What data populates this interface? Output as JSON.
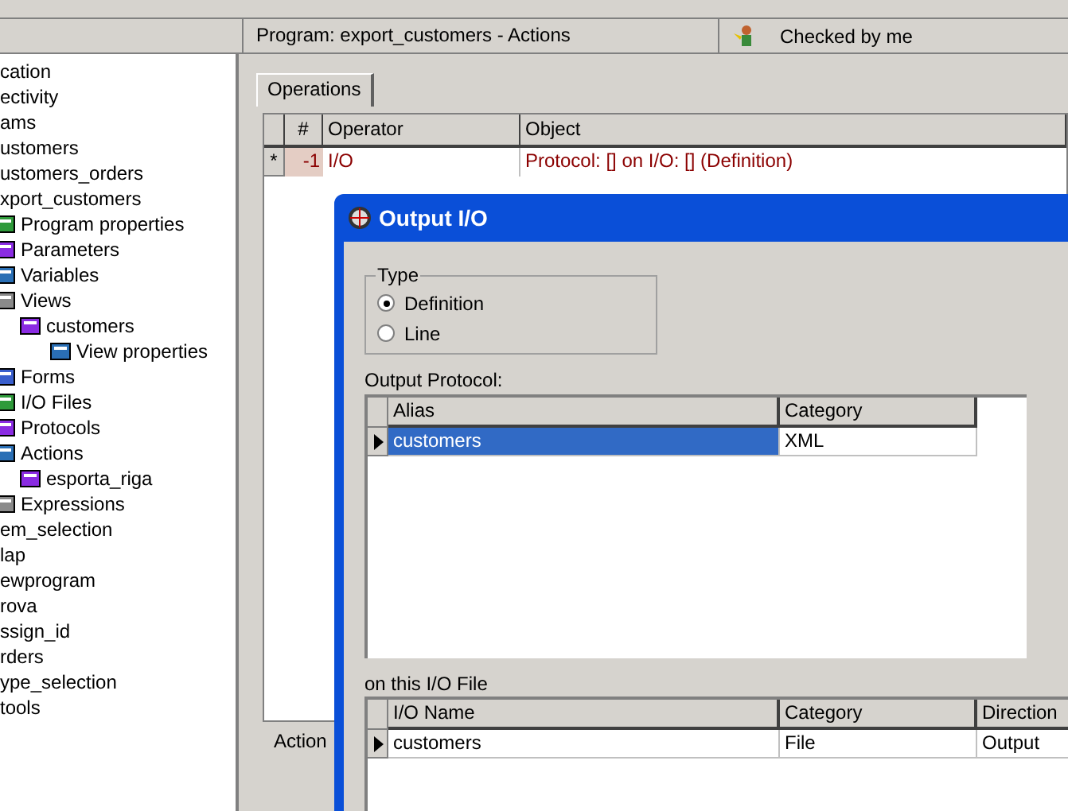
{
  "tree": [
    {
      "label": "cation"
    },
    {
      "label": "ectivity"
    },
    {
      "label": "ams"
    },
    {
      "label": "ustomers"
    },
    {
      "label": "ustomers_orders"
    },
    {
      "label": "xport_customers",
      "children": [
        {
          "label": "Program properties"
        },
        {
          "label": "Parameters"
        },
        {
          "label": "Variables"
        },
        {
          "label": "Views",
          "children": [
            {
              "label": "customers",
              "children": [
                {
                  "label": "View properties"
                }
              ]
            }
          ]
        },
        {
          "label": "Forms"
        },
        {
          "label": "I/O Files"
        },
        {
          "label": "Protocols"
        },
        {
          "label": "Actions",
          "children": [
            {
              "label": "esporta_riga"
            }
          ]
        },
        {
          "label": "Expressions"
        }
      ]
    },
    {
      "label": "em_selection"
    },
    {
      "label": "lap"
    },
    {
      "label": "ewprogram"
    },
    {
      "label": "rova"
    },
    {
      "label": "ssign_id"
    },
    {
      "label": "rders"
    },
    {
      "label": "ype_selection"
    },
    {
      "label": "tools"
    }
  ],
  "header": {
    "title": "Program: export_customers - Actions",
    "status": "Checked by me"
  },
  "tabs": [
    {
      "label": "Operations",
      "selected": true
    }
  ],
  "operations_grid": {
    "columns": [
      "#",
      "Operator",
      "Object"
    ],
    "rows": [
      {
        "marker": "*",
        "number": "-1",
        "operator": "I/O",
        "object": "Protocol: [] on I/O: [] (Definition)"
      }
    ]
  },
  "bottom_tabs": [
    {
      "label": "Action",
      "selected": false
    }
  ],
  "dialog": {
    "title": "Output I/O",
    "type_group": {
      "label": "Type",
      "options": [
        {
          "label": "Definition",
          "selected": true
        },
        {
          "label": "Line",
          "selected": false
        }
      ]
    },
    "protocol_label": "Output Protocol:",
    "protocol_grid": {
      "columns": [
        "Alias",
        "Category"
      ],
      "rows": [
        {
          "cells": [
            "customers",
            "XML"
          ],
          "current": true,
          "selected": true
        }
      ]
    },
    "file_label": "on this I/O File",
    "file_grid": {
      "columns": [
        "I/O Name",
        "Category",
        "Direction"
      ],
      "rows": [
        {
          "cells": [
            "customers",
            "File",
            "Output"
          ],
          "current": true,
          "selected": false
        }
      ]
    }
  }
}
